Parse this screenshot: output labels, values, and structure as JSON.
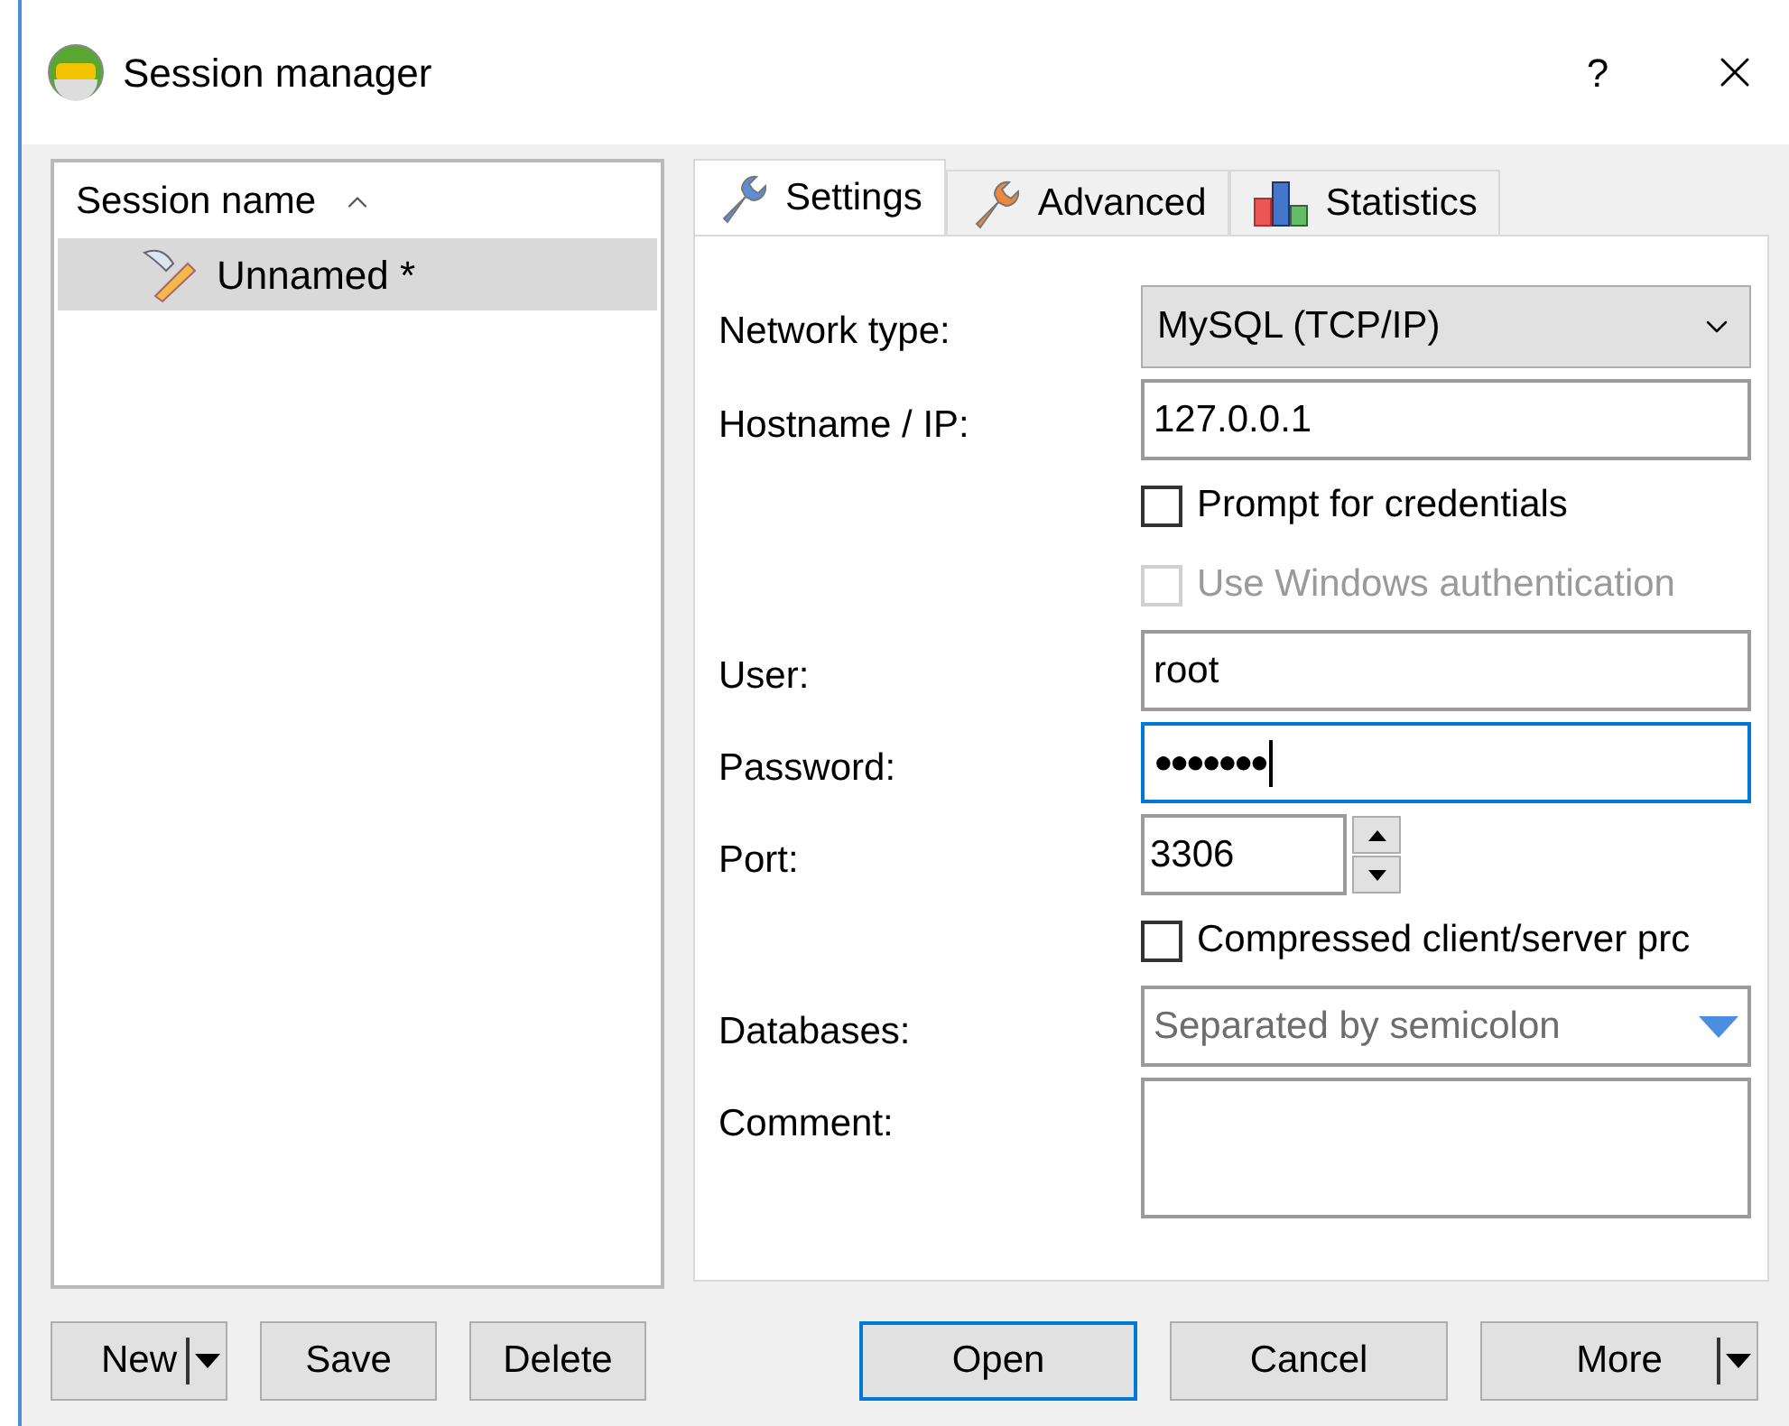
{
  "window": {
    "title": "Session manager",
    "help": "?"
  },
  "session_list": {
    "column": "Session name",
    "items": [
      {
        "name": "Unnamed *",
        "selected": true
      }
    ]
  },
  "tabs": [
    {
      "label": "Settings",
      "kind": "wrench",
      "color": "#5b8ed6",
      "selected": true
    },
    {
      "label": "Advanced",
      "kind": "wrench",
      "color": "#f0883a",
      "selected": false
    },
    {
      "label": "Statistics",
      "kind": "chart",
      "selected": false
    }
  ],
  "fields": [
    {
      "kind": "select",
      "label": "Network type:",
      "value": "MySQL (TCP/IP)"
    },
    {
      "kind": "text",
      "label": "Hostname / IP:",
      "value": "127.0.0.1"
    },
    {
      "kind": "checkbox",
      "label": "Prompt for credentials",
      "checked": false,
      "disabled": false
    },
    {
      "kind": "checkbox",
      "label": "Use Windows authentication",
      "checked": false,
      "disabled": true
    },
    {
      "kind": "text",
      "label": "User:",
      "value": "root"
    },
    {
      "kind": "password",
      "label": "Password:",
      "value": "●●●●●●●",
      "focused": true
    },
    {
      "kind": "spinner",
      "label": "Port:",
      "value": "3306"
    },
    {
      "kind": "checkbox",
      "label": "Compressed client/server prc",
      "checked": false,
      "disabled": false
    },
    {
      "kind": "combo",
      "label": "Databases:",
      "placeholder": "Separated by semicolon"
    },
    {
      "kind": "textarea",
      "label": "Comment:"
    }
  ],
  "left_buttons": [
    {
      "label": "New",
      "kind": "split"
    },
    {
      "label": "Save",
      "kind": "plain"
    },
    {
      "label": "Delete",
      "kind": "plain"
    }
  ],
  "right_buttons": [
    {
      "label": "Open",
      "kind": "plain",
      "default": true
    },
    {
      "label": "Cancel",
      "kind": "plain",
      "default": false
    },
    {
      "label": "More",
      "kind": "split",
      "default": false
    }
  ]
}
